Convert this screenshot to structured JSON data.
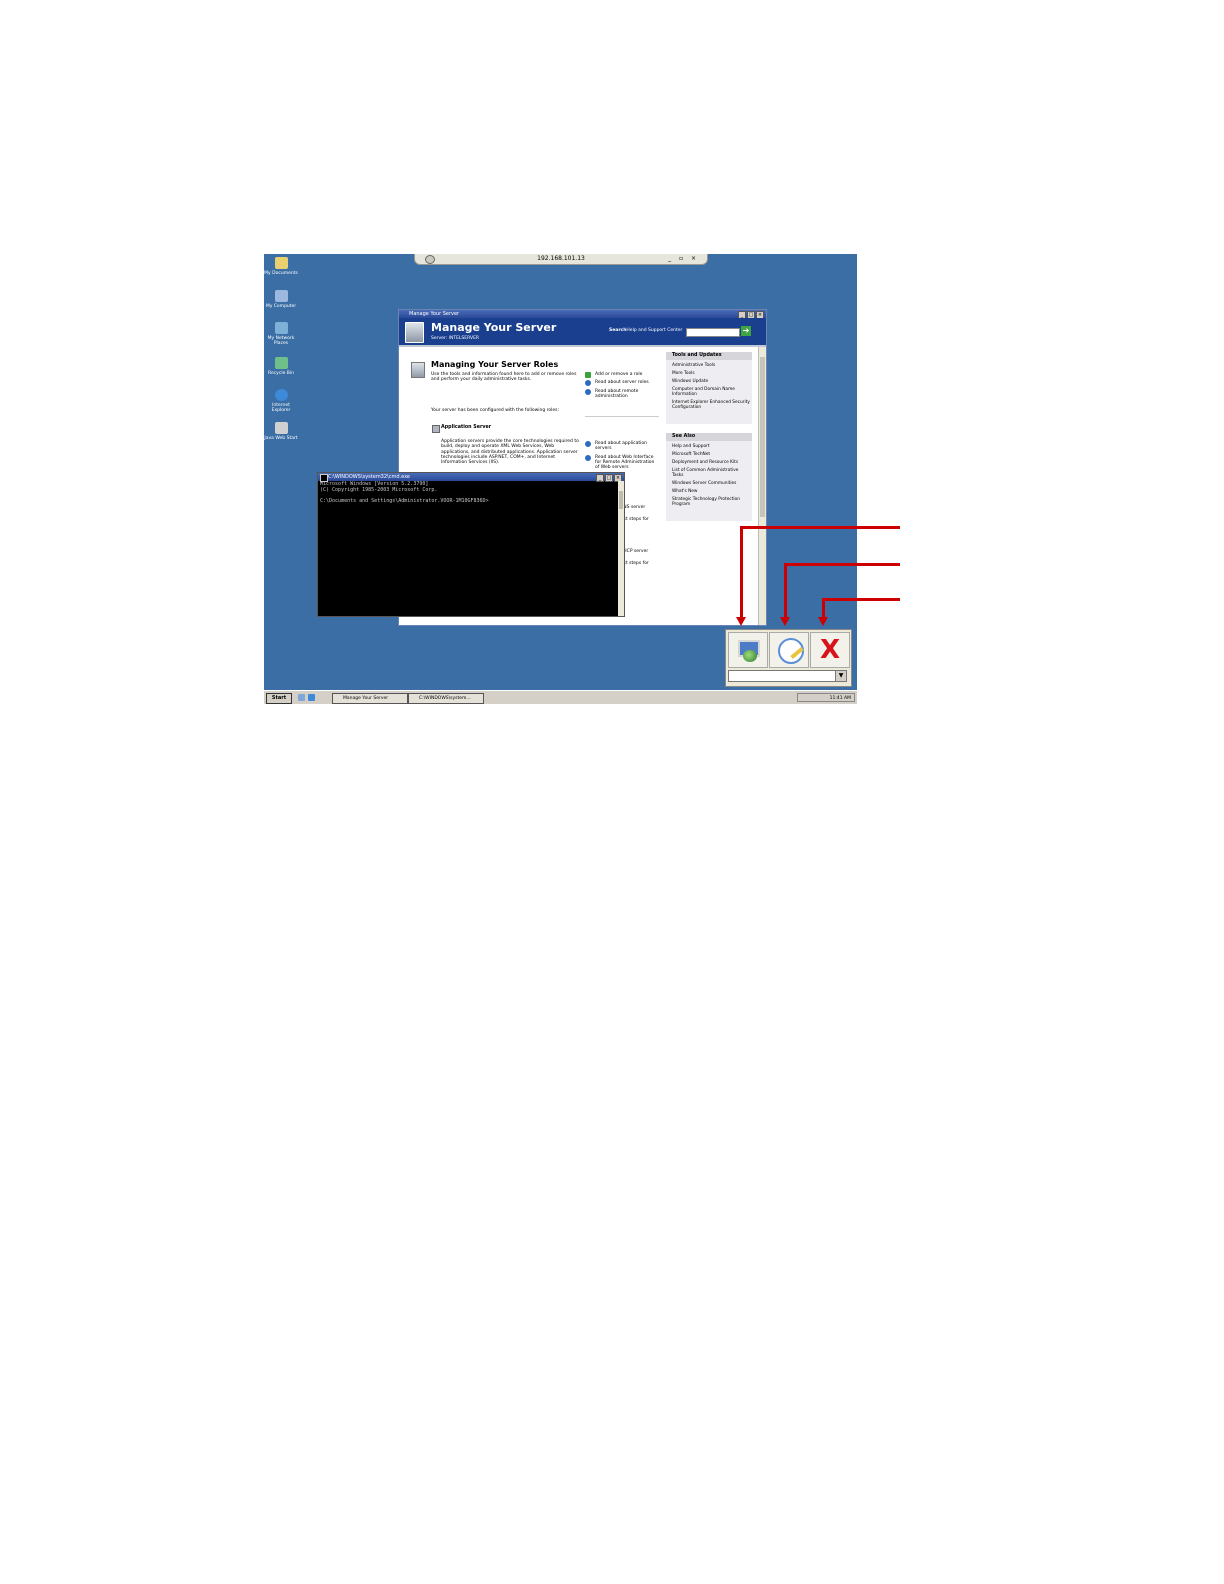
{
  "remote_bar": {
    "ip": "192.168.101.13"
  },
  "desktop_icons": [
    {
      "label": "My Documents"
    },
    {
      "label": "My Computer"
    },
    {
      "label": "My Network Places"
    },
    {
      "label": "Recycle Bin"
    },
    {
      "label": "Internet Explorer"
    },
    {
      "label": "Java Web Start"
    }
  ],
  "manage_server": {
    "window_title": "Manage Your Server",
    "banner_title": "Manage Your Server",
    "server_line": "Server: INTELSERVER",
    "search_bold": "Search",
    "search_rest": "Help and Support Center",
    "heading": "Managing Your Server Roles",
    "intro": "Use the tools and information found here to add or remove roles and perform your daily administrative tasks.",
    "configured": "Your server has been configured with the following roles:",
    "role_title": "Application Server",
    "role_desc": "Application servers provide the core technologies required to build, deploy and operate XML Web Services, Web applications, and distributed applications. Application server technologies include ASP.NET, COM+, and Internet Information Services (IIS).",
    "links_top": [
      "Add or remove a role",
      "Read about server roles",
      "Read about remote administration"
    ],
    "links_mid": [
      "Read about application servers",
      "Read about Web Interface for Remote Administration of Web servers",
      "...xt steps for"
    ],
    "fragments": [
      "...NS server",
      "...xt steps for",
      "...HCP server",
      "...xt steps for"
    ],
    "tools_header": "Tools and Updates",
    "tools_items": [
      "Administrative Tools",
      "More Tools",
      "Windows Update",
      "Computer and Domain Name Information",
      "Internet Explorer Enhanced Security Configuration"
    ],
    "see_also_header": "See Also",
    "see_also_items": [
      "Help and Support",
      "Microsoft TechNet",
      "Deployment and Resource Kits",
      "List of Common Administrative Tasks",
      "Windows Server Communities",
      "What's New",
      "Strategic Technology Protection Program"
    ]
  },
  "console": {
    "title": "C:\\WINDOWS\\system32\\cmd.exe",
    "lines": "Microsoft Windows [Version 5.2.3790]\n(C) Copyright 1985-2003 Microsoft Corp.\n\nC:\\Documents and Settings\\Administrator.VOOR-1M10GF836D>"
  },
  "toolbar": {
    "buttons": [
      "connect-icon",
      "configure-icon",
      "exit-icon"
    ],
    "exit_glyph": "X"
  },
  "taskbar": {
    "start": "Start",
    "tasks": [
      "Manage Your Server",
      "C:\\WINDOWS\\system..."
    ],
    "clock": "11:41 AM"
  },
  "colors": {
    "desktop": "#3a6ea5",
    "banner": "#1b3f8f",
    "callout": "#cc0000"
  }
}
